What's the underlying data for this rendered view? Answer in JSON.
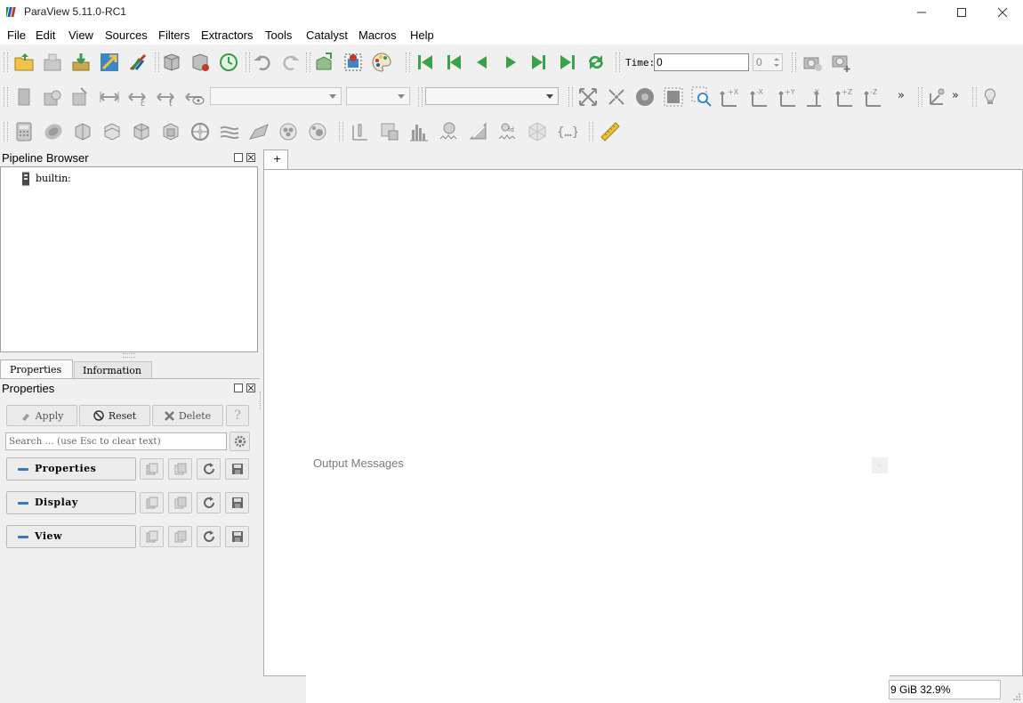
{
  "window": {
    "title": "ParaView 5.11.0-RC1"
  },
  "menu": [
    "File",
    "Edit",
    "View",
    "Sources",
    "Filters",
    "Extractors",
    "Tools",
    "Catalyst",
    "Macros",
    "Help"
  ],
  "toolbar": {
    "time_label": "Time:",
    "time_value": "0",
    "time_index": "0",
    "more_glyph": "»"
  },
  "pipeline": {
    "title": "Pipeline Browser",
    "root": "builtin:"
  },
  "tabs": {
    "properties": "Properties",
    "information": "Information"
  },
  "properties_panel": {
    "title": "Properties",
    "apply": "Apply",
    "reset": "Reset",
    "delete": "Delete",
    "help": "?",
    "search_placeholder": "Search ... (use Esc to clear text)",
    "sections": [
      "Properties",
      "Display",
      "View"
    ]
  },
  "view": {
    "tab_label": "+"
  },
  "output": {
    "title": "Output Messages"
  },
  "status": {
    "memory": "9 GiB 32.9%"
  },
  "colors": {
    "accent_blue": "#3a78c2",
    "play_green": "#3aa24a"
  }
}
